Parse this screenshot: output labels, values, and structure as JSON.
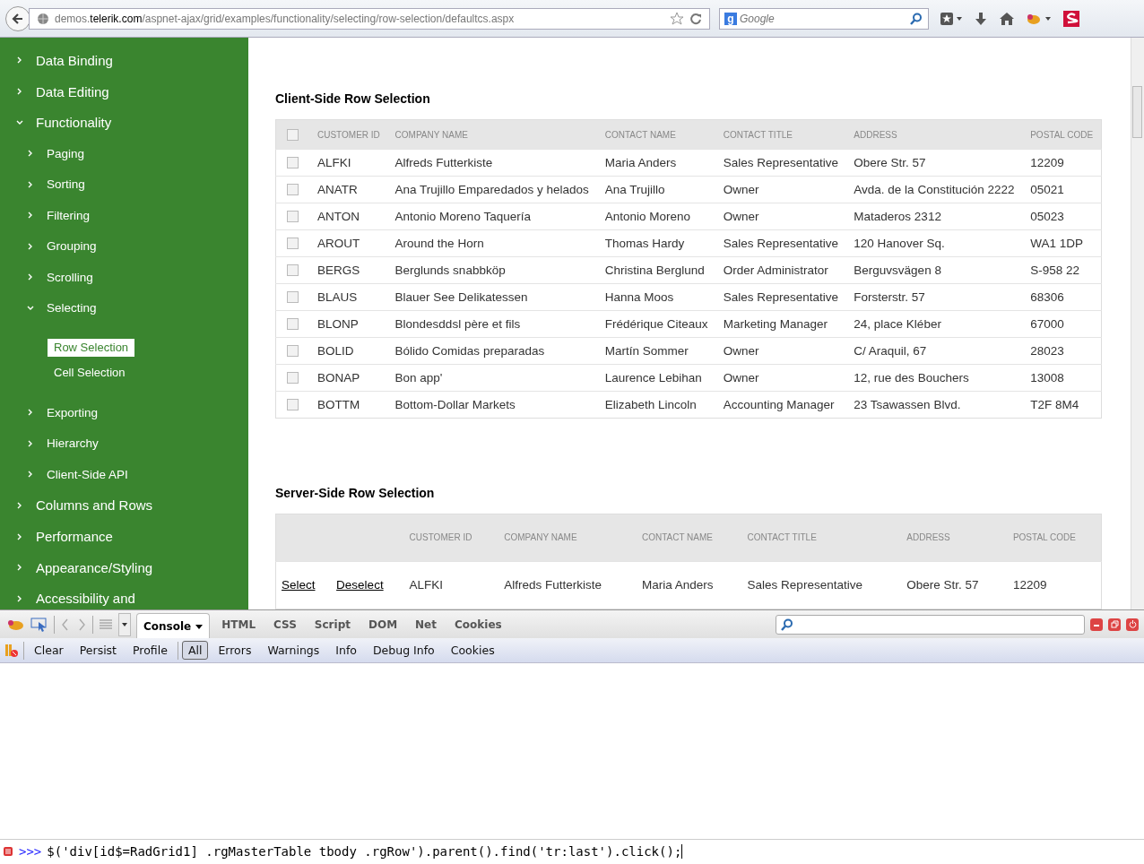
{
  "browser": {
    "url": "demos.**telerik.com**/aspnet-ajax/grid/examples/functionality/selecting/row-selection/defaultcs.aspx",
    "search": {
      "engine_letter": "g",
      "placeholder": "Google"
    }
  },
  "sidebar": {
    "items": [
      {
        "label": "Data Binding",
        "expanded": false
      },
      {
        "label": "Data Editing",
        "expanded": false
      },
      {
        "label": "Functionality",
        "expanded": true,
        "children": [
          {
            "label": "Paging",
            "expanded": false
          },
          {
            "label": "Sorting",
            "expanded": false
          },
          {
            "label": "Filtering",
            "expanded": false
          },
          {
            "label": "Grouping",
            "expanded": false
          },
          {
            "label": "Scrolling",
            "expanded": false
          },
          {
            "label": "Selecting",
            "expanded": true,
            "children": [
              {
                "label": "Row Selection",
                "selected": true
              },
              {
                "label": "Cell Selection",
                "selected": false
              }
            ]
          },
          {
            "label": "Exporting",
            "expanded": false
          },
          {
            "label": "Hierarchy",
            "expanded": false
          },
          {
            "label": "Client-Side API",
            "expanded": false
          }
        ]
      },
      {
        "label": "Columns and Rows",
        "expanded": false
      },
      {
        "label": "Performance",
        "expanded": false
      },
      {
        "label": "Appearance/Styling",
        "expanded": false
      },
      {
        "label": "Accessibility and",
        "expanded": false
      }
    ]
  },
  "client_grid": {
    "title": "Client-Side Row Selection",
    "header_checked": false,
    "columns": [
      "CUSTOMER ID",
      "COMPANY NAME",
      "CONTACT NAME",
      "CONTACT TITLE",
      "ADDRESS",
      "POSTAL CODE"
    ],
    "rows": [
      {
        "selected": false,
        "cells": [
          "ALFKI",
          "Alfreds Futterkiste",
          "Maria Anders",
          "Sales Representative",
          "Obere Str. 57",
          "12209"
        ]
      },
      {
        "selected": false,
        "cells": [
          "ANATR",
          "Ana Trujillo Emparedados y helados",
          "Ana Trujillo",
          "Owner",
          "Avda. de la Constitución 2222",
          "05021"
        ]
      },
      {
        "selected": false,
        "cells": [
          "ANTON",
          "Antonio Moreno Taquería",
          "Antonio Moreno",
          "Owner",
          "Mataderos 2312",
          "05023"
        ]
      },
      {
        "selected": false,
        "cells": [
          "AROUT",
          "Around the Horn",
          "Thomas Hardy",
          "Sales Representative",
          "120 Hanover Sq.",
          "WA1 1DP"
        ]
      },
      {
        "selected": false,
        "cells": [
          "BERGS",
          "Berglunds snabbköp",
          "Christina Berglund",
          "Order Administrator",
          "Berguvsvägen 8",
          "S-958 22"
        ]
      },
      {
        "selected": false,
        "cells": [
          "BLAUS",
          "Blauer See Delikatessen",
          "Hanna Moos",
          "Sales Representative",
          "Forsterstr. 57",
          "68306"
        ]
      },
      {
        "selected": false,
        "cells": [
          "BLONP",
          "Blondesddsl père et fils",
          "Frédérique Citeaux",
          "Marketing Manager",
          "24, place Kléber",
          "67000"
        ]
      },
      {
        "selected": false,
        "cells": [
          "BOLID",
          "Bólido Comidas preparadas",
          "Martín Sommer",
          "Owner",
          "C/ Araquil, 67",
          "28023"
        ]
      },
      {
        "selected": false,
        "cells": [
          "BONAP",
          "Bon app'",
          "Laurence Lebihan",
          "Owner",
          "12, rue des Bouchers",
          "13008"
        ]
      },
      {
        "selected": false,
        "cells": [
          "BOTTM",
          "Bottom-Dollar Markets",
          "Elizabeth Lincoln",
          "Accounting Manager",
          "23 Tsawassen Blvd.",
          "T2F 8M4"
        ]
      }
    ]
  },
  "server_grid": {
    "title": "Server-Side Row Selection",
    "columns": [
      "CUSTOMER ID",
      "COMPANY NAME",
      "CONTACT NAME",
      "CONTACT TITLE",
      "ADDRESS",
      "POSTAL CODE"
    ],
    "rows": [
      {
        "select": "Select",
        "deselect": "Deselect",
        "cells": [
          "ALFKI",
          "Alfreds Futterkiste",
          "Maria Anders",
          "Sales Representative",
          "Obere Str. 57",
          "12209"
        ]
      }
    ]
  },
  "devtools": {
    "tabs": [
      {
        "label": "Console",
        "selected": true
      },
      {
        "label": "HTML",
        "selected": false
      },
      {
        "label": "CSS",
        "selected": false
      },
      {
        "label": "Script",
        "selected": false
      },
      {
        "label": "DOM",
        "selected": false
      },
      {
        "label": "Net",
        "selected": false
      },
      {
        "label": "Cookies",
        "selected": false
      }
    ],
    "actions": [
      "Clear",
      "Persist",
      "Profile"
    ],
    "filters": [
      {
        "label": "All",
        "selected": true
      },
      {
        "label": "Errors",
        "selected": false
      },
      {
        "label": "Warnings",
        "selected": false
      },
      {
        "label": "Info",
        "selected": false
      },
      {
        "label": "Debug Info",
        "selected": false
      },
      {
        "label": "Cookies",
        "selected": false
      }
    ],
    "prompt": ">>>",
    "command": "$('div[id$=RadGrid1] .rgMasterTable tbody .rgRow').parent().find('tr:last').click();"
  }
}
